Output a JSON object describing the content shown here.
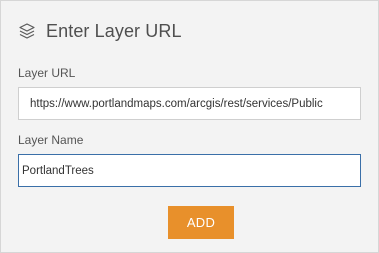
{
  "header": {
    "title": "Enter Layer URL",
    "icon": "layers-icon"
  },
  "form": {
    "layer_url": {
      "label": "Layer URL",
      "value": "https://www.portlandmaps.com/arcgis/rest/services/Public"
    },
    "layer_name": {
      "label": "Layer Name",
      "value": "PortlandTrees"
    },
    "add_button": "ADD"
  },
  "colors": {
    "accent": "#e8902b",
    "focus_border": "#3a6fa8",
    "panel_bg": "#f3f3f3"
  }
}
